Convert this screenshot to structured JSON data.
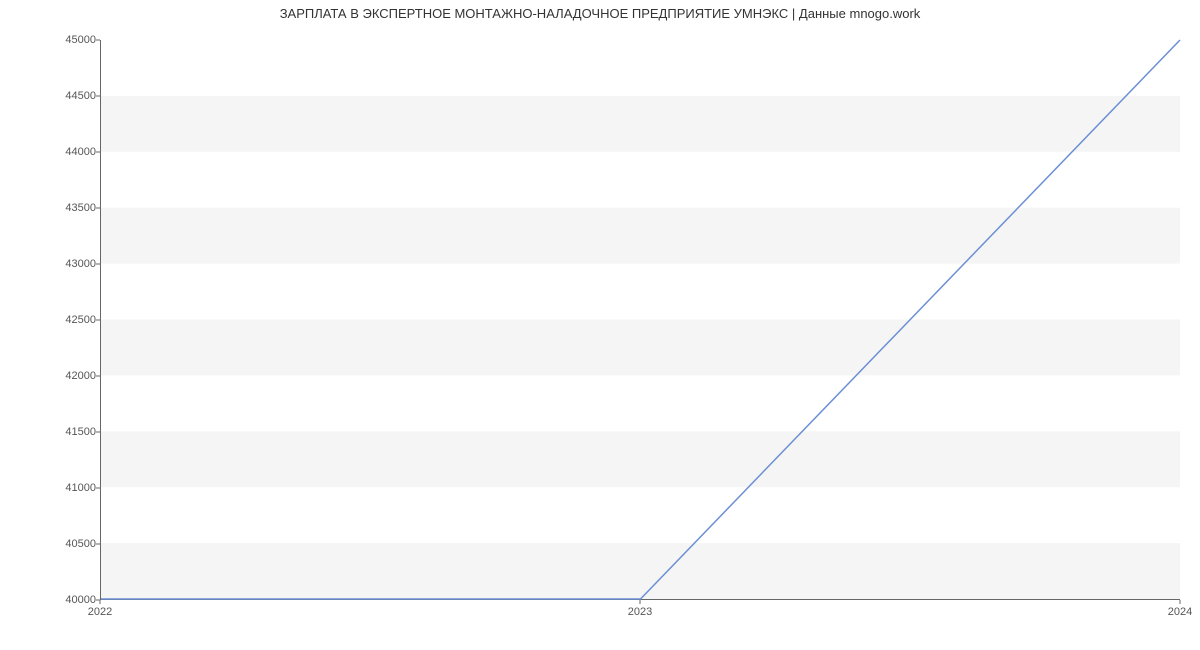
{
  "chart_data": {
    "type": "line",
    "title": "ЗАРПЛАТА В  ЭКСПЕРТНОЕ МОНТАЖНО-НАЛАДОЧНОЕ ПРЕДПРИЯТИЕ УМНЭКС | Данные mnogo.work",
    "x": [
      2022,
      2023,
      2024
    ],
    "series": [
      {
        "name": "salary",
        "values": [
          40000,
          40000,
          45000
        ],
        "color": "#6b8fd4"
      }
    ],
    "x_ticks": [
      2022,
      2023,
      2024
    ],
    "y_ticks": [
      40000,
      40500,
      41000,
      41500,
      42000,
      42500,
      43000,
      43500,
      44000,
      44500,
      45000
    ],
    "xlim": [
      2022,
      2024
    ],
    "ylim": [
      40000,
      45000
    ],
    "xlabel": "",
    "ylabel": ""
  }
}
